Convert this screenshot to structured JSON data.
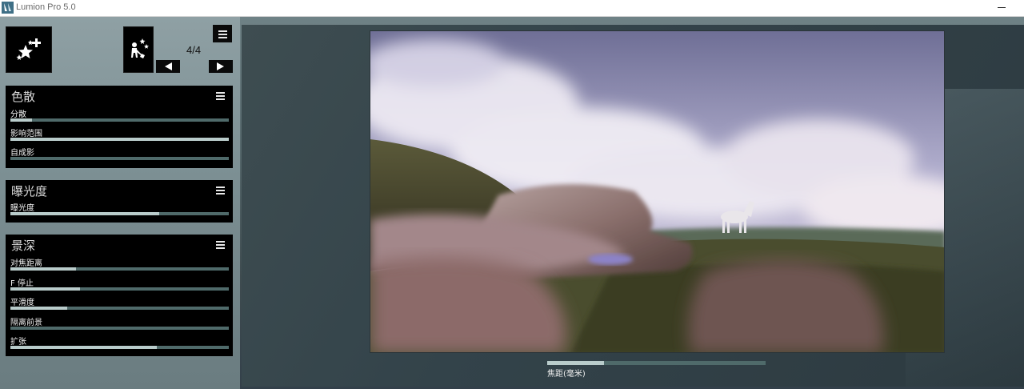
{
  "window": {
    "title": "Lumion Pro 5.0"
  },
  "top_controls": {
    "add_effect_icon": "sparkles-plus-icon",
    "effect_thumbnail_icon": "painter-stars-icon",
    "menu_icon": "hamburger-icon",
    "prev_icon": "triangle-left-icon",
    "next_icon": "triangle-right-icon",
    "page_indicator": "4/4"
  },
  "panels": [
    {
      "title": "色散",
      "sliders": [
        {
          "label": "分散",
          "value": 0.1
        },
        {
          "label": "影响范围",
          "value": 1.0
        },
        {
          "label": "自成影",
          "value": 0.0
        }
      ]
    },
    {
      "title": "曝光度",
      "sliders": [
        {
          "label": "曝光度",
          "value": 0.68
        }
      ]
    },
    {
      "title": "景深",
      "sliders": [
        {
          "label": "对焦距离",
          "value": 0.3
        },
        {
          "label": "F 停止",
          "value": 0.32
        },
        {
          "label": "平滑度",
          "value": 0.26
        },
        {
          "label": "隔离前景",
          "value": 0.0
        },
        {
          "label": "扩张",
          "value": 0.67
        }
      ]
    }
  ],
  "viewport": {
    "focal_label": "焦距(毫米)",
    "focal_value": 0.26
  },
  "colors": {
    "panel_bg": "#000000",
    "slider_track": "#4f6a6a",
    "slider_fill": "#b9cccb"
  }
}
